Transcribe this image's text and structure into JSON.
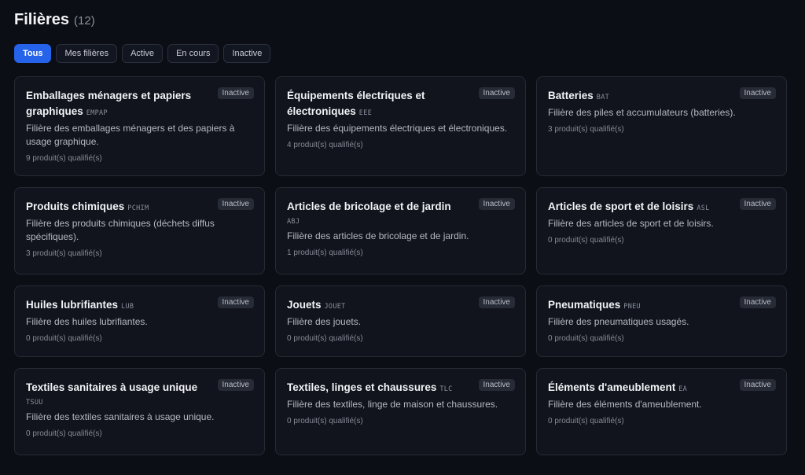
{
  "header": {
    "title": "Filières",
    "count": "(12)"
  },
  "filters": [
    {
      "label": "Tous",
      "active": true
    },
    {
      "label": "Mes filières",
      "active": false
    },
    {
      "label": "Active",
      "active": false
    },
    {
      "label": "En cours",
      "active": false
    },
    {
      "label": "Inactive",
      "active": false
    }
  ],
  "cards": [
    {
      "name": "Emballages ménagers et papiers graphiques",
      "code": "EMPAP",
      "status": "Inactive",
      "description": "Filière des emballages ménagers et des papiers à usage graphique.",
      "products": "9 produit(s) qualifié(s)"
    },
    {
      "name": "Équipements électriques et électroniques",
      "code": "EEE",
      "status": "Inactive",
      "description": "Filière des équipements électriques et électroniques.",
      "products": "4 produit(s) qualifié(s)"
    },
    {
      "name": "Batteries",
      "code": "BAT",
      "status": "Inactive",
      "description": "Filière des piles et accumulateurs (batteries).",
      "products": "3 produit(s) qualifié(s)"
    },
    {
      "name": "Produits chimiques",
      "code": "PCHIM",
      "status": "Inactive",
      "description": "Filière des produits chimiques (déchets diffus spécifiques).",
      "products": "3 produit(s) qualifié(s)"
    },
    {
      "name": "Articles de bricolage et de jardin",
      "code": "ABJ",
      "status": "Inactive",
      "description": "Filière des articles de bricolage et de jardin.",
      "products": "1 produit(s) qualifié(s)"
    },
    {
      "name": "Articles de sport et de loisirs",
      "code": "ASL",
      "status": "Inactive",
      "description": "Filière des articles de sport et de loisirs.",
      "products": "0 produit(s) qualifié(s)"
    },
    {
      "name": "Huiles lubrifiantes",
      "code": "LUB",
      "status": "Inactive",
      "description": "Filière des huiles lubrifiantes.",
      "products": "0 produit(s) qualifié(s)"
    },
    {
      "name": "Jouets",
      "code": "JOUET",
      "status": "Inactive",
      "description": "Filière des jouets.",
      "products": "0 produit(s) qualifié(s)"
    },
    {
      "name": "Pneumatiques",
      "code": "PNEU",
      "status": "Inactive",
      "description": "Filière des pneumatiques usagés.",
      "products": "0 produit(s) qualifié(s)"
    },
    {
      "name": "Textiles sanitaires à usage unique",
      "code": "TSUU",
      "status": "Inactive",
      "description": "Filière des textiles sanitaires à usage unique.",
      "products": "0 produit(s) qualifié(s)"
    },
    {
      "name": "Textiles, linges et chaussures",
      "code": "TLC",
      "status": "Inactive",
      "description": "Filière des textiles, linge de maison et chaussures.",
      "products": "0 produit(s) qualifié(s)"
    },
    {
      "name": "Éléments d'ameublement",
      "code": "EA",
      "status": "Inactive",
      "description": "Filière des éléments d'ameublement.",
      "products": "0 produit(s) qualifié(s)"
    }
  ]
}
